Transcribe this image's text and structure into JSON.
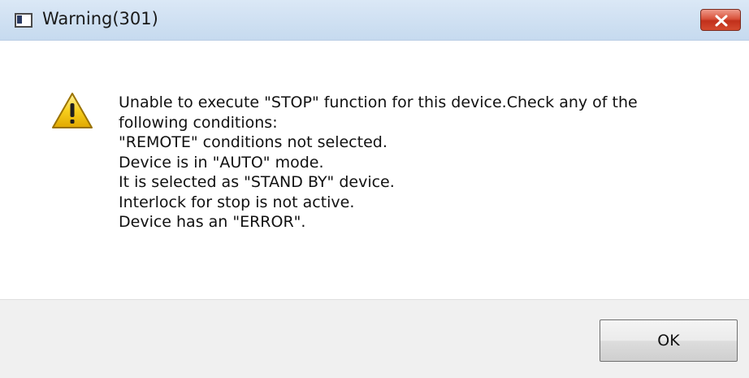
{
  "window": {
    "title": "Warning(301)"
  },
  "message": {
    "lines": [
      "Unable to execute \"STOP\" function for this device.Check any of the",
      "following conditions:",
      "\"REMOTE\" conditions not selected.",
      "Device is in \"AUTO\" mode.",
      "It is selected as \"STAND BY\" device.",
      "Interlock for stop is not active.",
      "Device has an \"ERROR\"."
    ]
  },
  "buttons": {
    "ok_label": "OK"
  },
  "icons": {
    "app": "window-app-icon",
    "close": "close-icon",
    "message": "warning-icon"
  },
  "colors": {
    "close_button": "#c1301b",
    "warning_fill": "#f5c400",
    "titlebar": "#d2e2f3",
    "footer": "#f0f0f0"
  }
}
